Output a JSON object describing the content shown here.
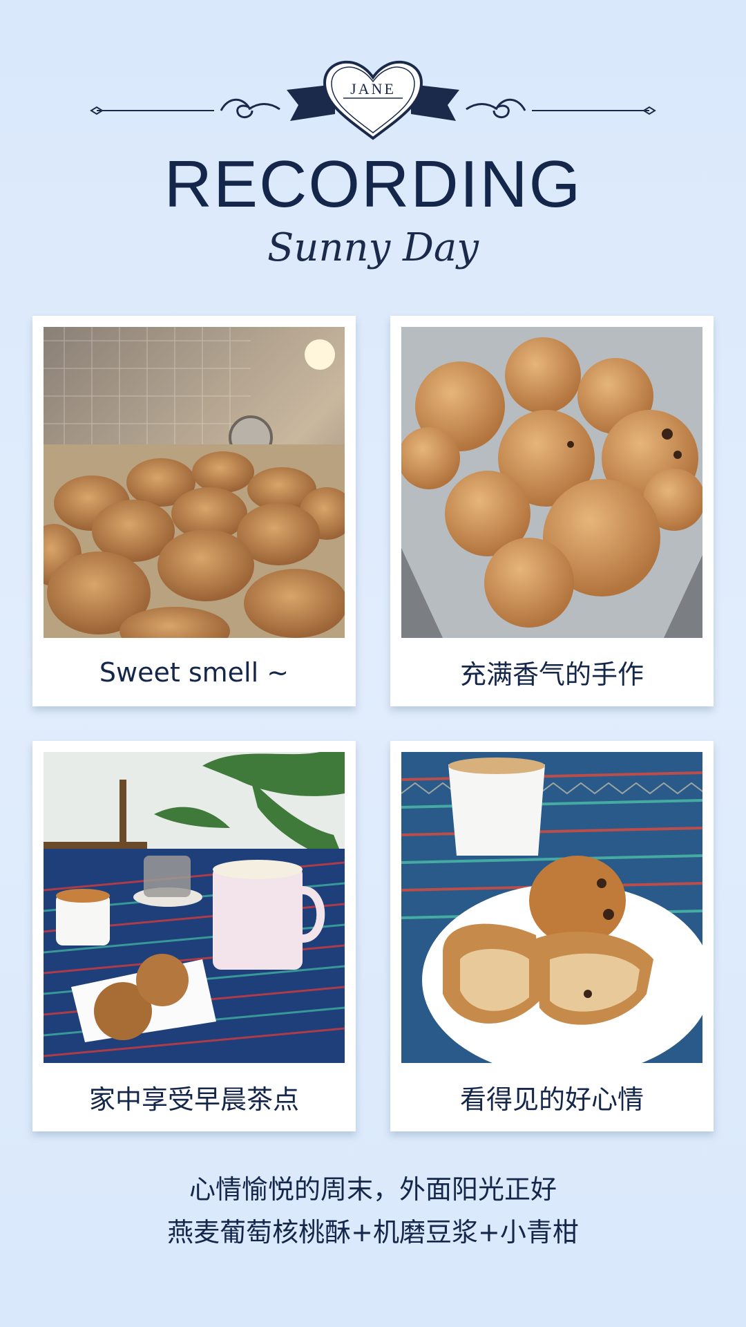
{
  "header": {
    "badge_text": "JANE",
    "title": "RECORDING",
    "subtitle": "Sunny Day"
  },
  "cards": [
    {
      "caption": "Sweet smell ~",
      "photo": "cookies-on-oven-tray"
    },
    {
      "caption": "充满香气的手作",
      "photo": "cookies-in-plastic-container"
    },
    {
      "caption": "家中享受早晨茶点",
      "photo": "breakfast-table-with-tea-and-mug"
    },
    {
      "caption": "看得见的好心情",
      "photo": "broken-cookies-on-plate-with-tea"
    }
  ],
  "footer": {
    "line1": "心情愉悦的周末，外面阳光正好",
    "line2": "燕麦葡萄核桃酥+机磨豆浆+小青柑"
  },
  "colors": {
    "background": "#dce9fb",
    "navy": "#14264a",
    "card": "#ffffff"
  }
}
